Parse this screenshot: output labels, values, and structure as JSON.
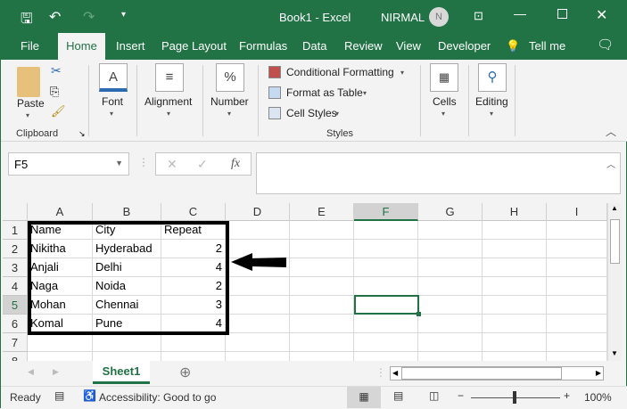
{
  "title": {
    "doc": "Book1  -  Excel",
    "user": "NIRMAL",
    "avatar": "N"
  },
  "tabs": [
    "File",
    "Home",
    "Insert",
    "Page Layout",
    "Formulas",
    "Data",
    "Review",
    "View",
    "Developer",
    "Tell me"
  ],
  "ribbon": {
    "paste": "Paste",
    "clipboard": "Clipboard",
    "font": "Font",
    "alignment": "Alignment",
    "number": "Number",
    "cond": "Conditional Formatting",
    "fmt_table": "Format as Table",
    "cell_styles": "Cell Styles",
    "styles": "Styles",
    "cells": "Cells",
    "editing": "Editing"
  },
  "formula": {
    "name_box": "F5",
    "fx": "fx",
    "value": ""
  },
  "columns": [
    "A",
    "B",
    "C",
    "D",
    "E",
    "F",
    "G",
    "H",
    "I"
  ],
  "rows": [
    [
      "Name",
      "City",
      "Repeat"
    ],
    [
      "Nikitha",
      "Hyderabad",
      "2"
    ],
    [
      "Anjali",
      "Delhi",
      "4"
    ],
    [
      "Naga",
      "Noida",
      "2"
    ],
    [
      "Mohan",
      "Chennai",
      "3"
    ],
    [
      "Komal",
      "Pune",
      "4"
    ]
  ],
  "active_cell": "F5",
  "sheet_tab": "Sheet1",
  "status": {
    "ready": "Ready",
    "accessibility": "Accessibility: Good to go",
    "zoom": "100%"
  },
  "colors": {
    "accent": "#217346"
  }
}
